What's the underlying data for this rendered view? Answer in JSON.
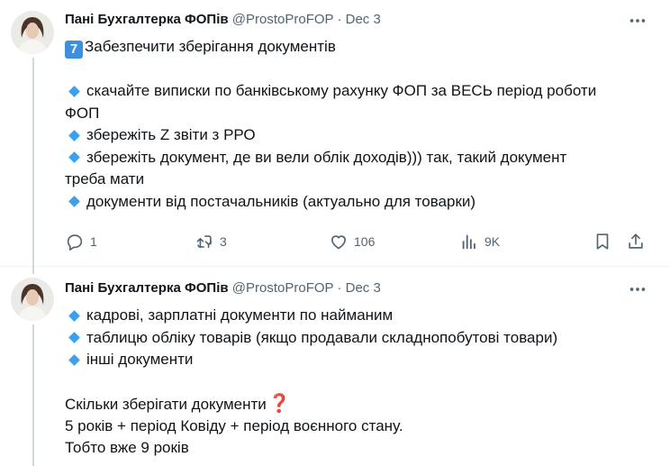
{
  "colors": {
    "accent": "#1d9bf0",
    "meta": "#536471",
    "text": "#0f1419",
    "divider": "#eff3f4"
  },
  "tweets": [
    {
      "author": "Пані Бухгалтерка ФОПів",
      "handle": "@ProstoProFOP",
      "separator": "·",
      "date": "Dec 3",
      "lines": {
        "l1": "Забезпечити зберігання документів",
        "l3": "скачайте виписки по банківському рахунку ФОП за ВЕСЬ період роботи",
        "l4": "ФОП",
        "l5": "збережіть Z звіти з РРО",
        "l6": "збережіть документ, де ви вели облік доходів))) так, такий документ",
        "l7": "треба мати",
        "l8": "документи від постачальників (актуально для товарки)"
      },
      "number_emoji": "7",
      "bullet_icon": "blue-diamond-icon",
      "actions": {
        "replies": "1",
        "reposts": "3",
        "likes": "106",
        "views": "9K"
      }
    },
    {
      "author": "Пані Бухгалтерка ФОПів",
      "handle": "@ProstoProFOP",
      "separator": "·",
      "date": "Dec 3",
      "lines": {
        "l1": "кадрові, зарплатні документи по найманим",
        "l2": "таблицю обліку товарів (якщо продавали складнопобутові товари)",
        "l3": "інші документи",
        "l5": "Скільки зберігати документи",
        "l6": "5 років + період Ковіду + період воєнного стану.",
        "l7": "Тобто вже 9 років"
      },
      "question_emoji": "❓"
    }
  ]
}
